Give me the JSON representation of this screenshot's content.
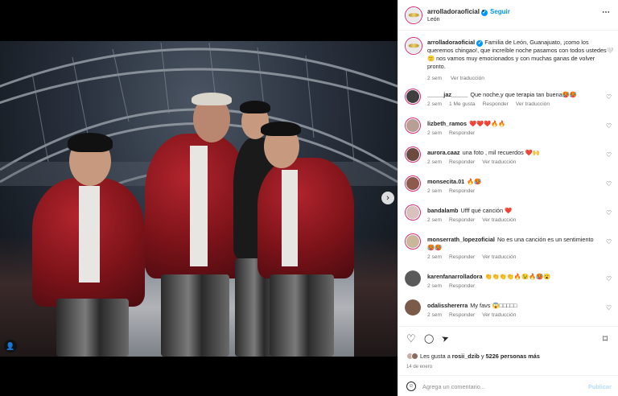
{
  "post": {
    "username": "arrolladoraoficial",
    "follow_label": "Seguir",
    "separator": "•",
    "location": "León",
    "more_icon": "⋯"
  },
  "caption": {
    "username": "arrolladoraoficial",
    "text": "Familia de León, Guanajuato, ¡como los queremos chingao!, que increíble noche pasamos con todos ustedes🤍🙂 nos vamos muy emocionados y con muchas ganas de volver pronto.",
    "time": "2 sem",
    "translate": "Ver traducción"
  },
  "comments": [
    {
      "user": "_____jaz_____",
      "text": "Que noche,y que terapia tan buena🥵🥵",
      "time": "2 sem",
      "likes": "1 Me gusta",
      "reply": "Responder",
      "translate": "Ver traducción"
    },
    {
      "user": "lizbeth_ramos",
      "text": "❤️❤️❤️🔥🔥",
      "time": "2 sem",
      "likes": "",
      "reply": "Responder",
      "translate": ""
    },
    {
      "user": "aurora.caaz",
      "text": "una foto , mil recuerdos ❤️🙌",
      "time": "2 sem",
      "likes": "",
      "reply": "Responder",
      "translate": "Ver traducción"
    },
    {
      "user": "monsecita.01",
      "text": "🔥🥵",
      "time": "2 sem",
      "likes": "",
      "reply": "Responder",
      "translate": ""
    },
    {
      "user": "bandalamb",
      "text": "Ufff qué canción ❤️",
      "time": "2 sem",
      "likes": "",
      "reply": "Responder",
      "translate": "Ver traducción"
    },
    {
      "user": "monserrath_lopezoficial",
      "text": "No es una canción es un sentimiento 🥵🥵",
      "time": "2 sem",
      "likes": "",
      "reply": "Responder",
      "translate": "Ver traducción"
    },
    {
      "user": "karenfanarrolladora",
      "text": "👏👏👏👏🔥😉🔥🥵😮",
      "time": "2 sem",
      "likes": "",
      "reply": "Responder",
      "translate": ""
    },
    {
      "user": "odalisshererra",
      "text": "My favs 😱□□□□□",
      "time": "2 sem",
      "likes": "",
      "reply": "Responder",
      "translate": "Ver traducción"
    }
  ],
  "actions": {
    "like_icon": "♡",
    "comment_icon": "◯",
    "share_icon": "➤",
    "save_icon": "⌑"
  },
  "likes": {
    "prefix": "Les gusta a",
    "first_user": "rosii_dzib",
    "middle": "y",
    "count": "5226 personas más"
  },
  "date": "14 de enero",
  "composer": {
    "emoji_icon": "☺",
    "placeholder": "Agrega un comentario...",
    "publish_label": "Publicar"
  },
  "media": {
    "next_icon": "›",
    "user_tag_icon": "👤"
  },
  "colors": {
    "accent": "#0095f6",
    "story_ring": "#d62976",
    "muted": "#737373"
  }
}
